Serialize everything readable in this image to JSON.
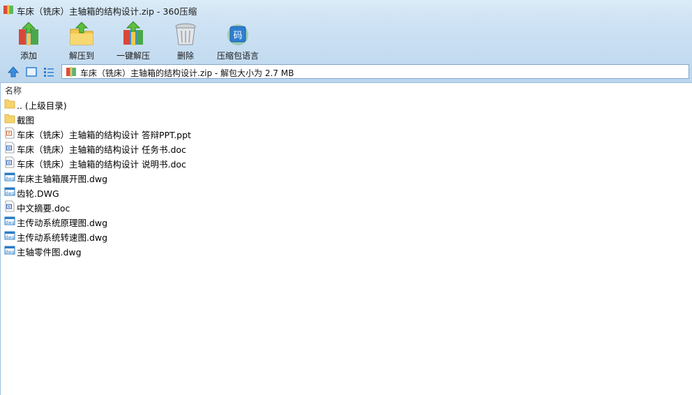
{
  "window": {
    "title": "车床（铣床）主轴箱的结构设计.zip - 360压缩"
  },
  "toolbar": {
    "buttons": [
      {
        "label": "添加",
        "icon": "add-archive-icon"
      },
      {
        "label": "解压到",
        "icon": "extract-to-icon"
      },
      {
        "label": "一键解压",
        "icon": "one-click-extract-icon"
      },
      {
        "label": "删除",
        "icon": "trash-bin-icon"
      },
      {
        "label": "压缩包语言",
        "icon": "archive-language-icon"
      }
    ],
    "language_badge": "码"
  },
  "addressbar": {
    "path_text": "车床（铣床）主轴箱的结构设计.zip - 解包大小为 2.7 MB"
  },
  "list": {
    "column_name": "名称",
    "items": [
      {
        "name": ".. (上级目录)",
        "type": "folder"
      },
      {
        "name": "截图",
        "type": "folder"
      },
      {
        "name": "车床（铣床）主轴箱的结构设计 答辩PPT.ppt",
        "type": "ppt"
      },
      {
        "name": "车床（铣床）主轴箱的结构设计 任务书.doc",
        "type": "doc"
      },
      {
        "name": "车床（铣床）主轴箱的结构设计 说明书.doc",
        "type": "doc"
      },
      {
        "name": "车床主轴箱展开图.dwg",
        "type": "dwg"
      },
      {
        "name": "齿轮.DWG",
        "type": "dwg"
      },
      {
        "name": "中文摘要.doc",
        "type": "doc"
      },
      {
        "name": "主传动系统原理图.dwg",
        "type": "dwg"
      },
      {
        "name": "主传动系统转速图.dwg",
        "type": "dwg"
      },
      {
        "name": "主轴零件图.dwg",
        "type": "dwg"
      }
    ]
  },
  "colors": {
    "chrome_top": "#dcecf8",
    "chrome_bottom": "#c3dbf0",
    "folder": "#f6d36b",
    "dwg_blue": "#2a7cc7"
  }
}
